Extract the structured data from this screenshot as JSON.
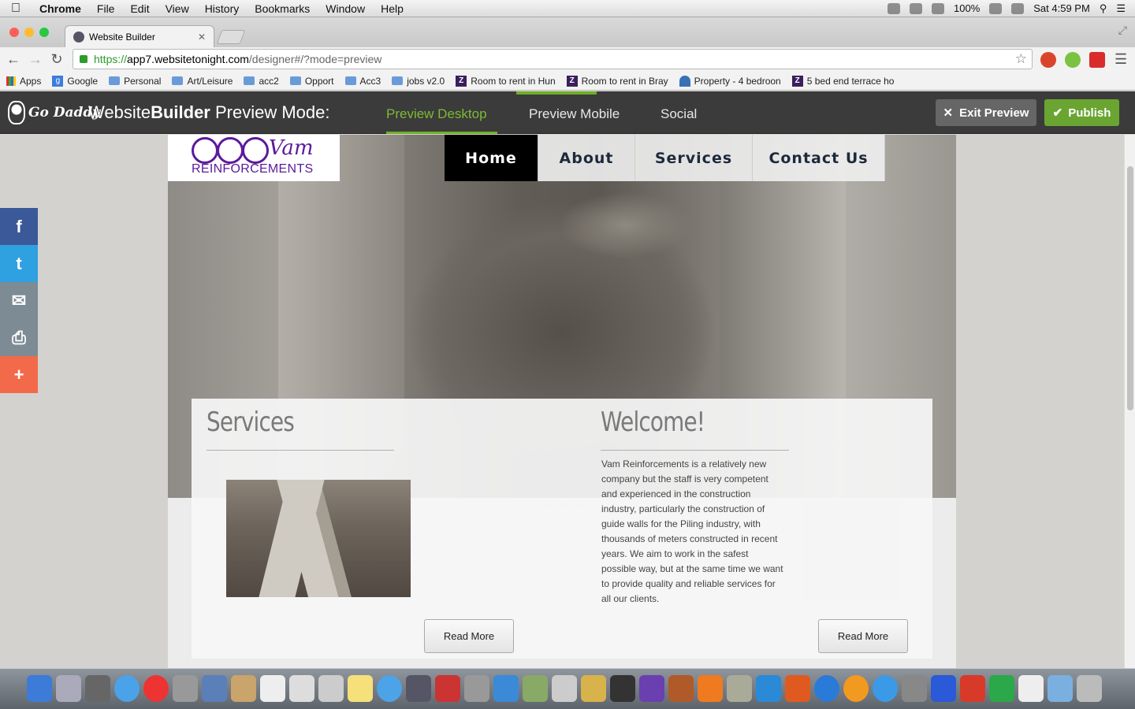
{
  "menubar": {
    "app": "Chrome",
    "items": [
      "File",
      "Edit",
      "View",
      "History",
      "Bookmarks",
      "Window",
      "Help"
    ],
    "battery": "100%",
    "clock": "Sat 4:59 PM"
  },
  "browser": {
    "tab_title": "Website Builder",
    "url_scheme": "https://",
    "url_host": "app7.websitetonight.com",
    "url_path": "/designer#/?mode=preview",
    "bookmarks": [
      {
        "label": "Apps",
        "kind": "grid"
      },
      {
        "label": "Google",
        "kind": "google"
      },
      {
        "label": "Personal",
        "kind": "folder"
      },
      {
        "label": "Art/Leisure",
        "kind": "folder"
      },
      {
        "label": "acc2",
        "kind": "folder"
      },
      {
        "label": "Opport",
        "kind": "folder"
      },
      {
        "label": "Acc3",
        "kind": "folder"
      },
      {
        "label": "jobs v2.0",
        "kind": "folder"
      },
      {
        "label": "Room to rent in Hun",
        "kind": "zoopla"
      },
      {
        "label": "Room to rent in Bray",
        "kind": "zoopla"
      },
      {
        "label": "Property - 4 bedroon",
        "kind": "property"
      },
      {
        "label": "5 bed end terrace ho",
        "kind": "zoopla"
      }
    ]
  },
  "builder": {
    "logo_text": "Go Daddy",
    "title_prefix": "Website",
    "title_bold": "Builder",
    "title_suffix": " Preview Mode:",
    "tabs": [
      "Preview Desktop",
      "Preview Mobile",
      "Social"
    ],
    "exit_label": "Exit Preview",
    "publish_label": "Publish",
    "colors": {
      "accent": "#6fae27",
      "bar": "#3b3b3b"
    }
  },
  "site": {
    "logo_script": "Vam",
    "logo_word": "REINFORCEMENTS",
    "nav": [
      "Home",
      "About",
      "Services",
      "Contact Us"
    ],
    "services_heading": "Services",
    "welcome_heading": "Welcome!",
    "welcome_body": "Vam Reinforcements is a relatively new company but the staff is very competent and experienced in the construction industry, particularly the construction of guide walls for the Piling industry, with thousands of meters constructed in recent years. We aim to work in the safest possible way, but at the same time we want to provide quality and reliable services for all our clients.",
    "read_more_1": "Read More",
    "read_more_2": "Read More",
    "brand_color": "#5b1a9b"
  },
  "social": [
    {
      "icon": "facebook-icon",
      "glyph": "f",
      "color": "#3b5998"
    },
    {
      "icon": "twitter-icon",
      "glyph": "t",
      "color": "#2fa0e0"
    },
    {
      "icon": "email-icon",
      "glyph": "✉",
      "color": "#7d8b95"
    },
    {
      "icon": "print-icon",
      "glyph": "⎙",
      "color": "#7d8b95"
    },
    {
      "icon": "share-icon",
      "glyph": "+",
      "color": "#f26a4a"
    }
  ]
}
